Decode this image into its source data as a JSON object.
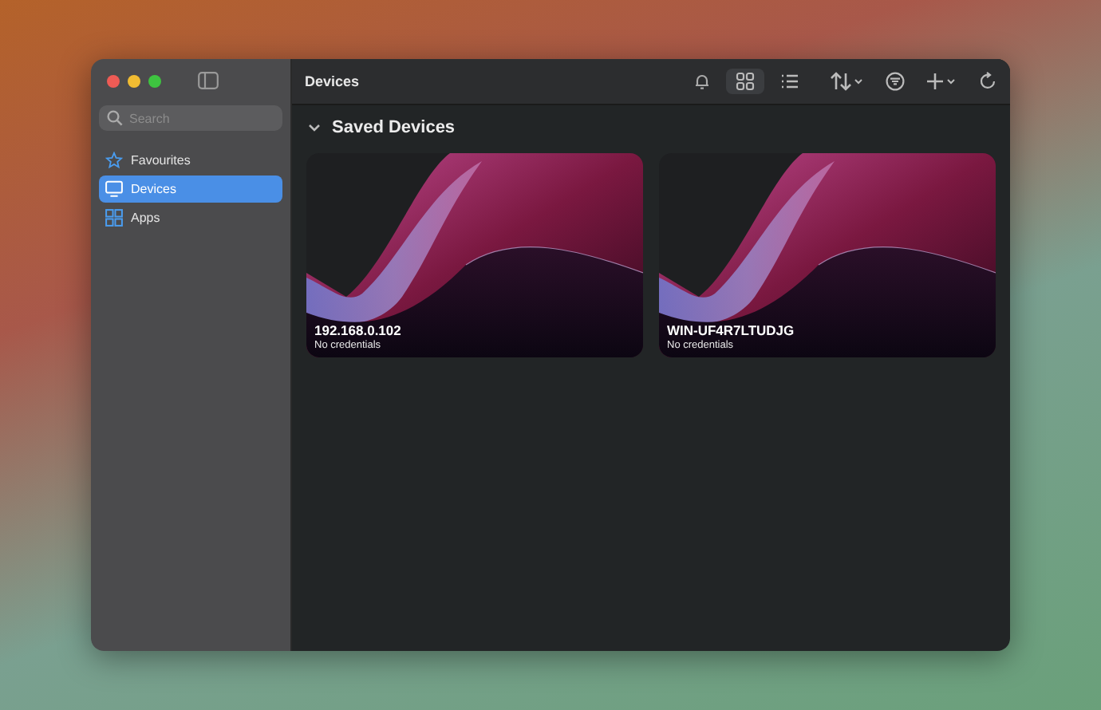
{
  "window": {
    "title": "Devices"
  },
  "sidebar": {
    "search": {
      "placeholder": "Search"
    },
    "items": [
      {
        "label": "Favourites",
        "selected": false
      },
      {
        "label": "Devices",
        "selected": true
      },
      {
        "label": "Apps",
        "selected": false
      }
    ]
  },
  "toolbar": {
    "view_modes": [
      {
        "selected": true
      },
      {
        "selected": false
      }
    ]
  },
  "section": {
    "title": "Saved Devices",
    "expanded": true
  },
  "devices": [
    {
      "name": "192.168.0.102",
      "status": "No credentials"
    },
    {
      "name": "WIN-UF4R7LTUDJG",
      "status": "No credentials"
    }
  ]
}
